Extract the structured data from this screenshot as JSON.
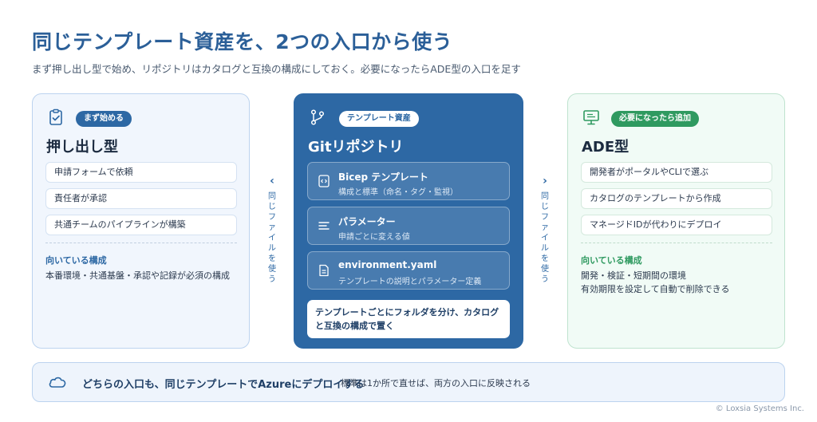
{
  "title": "同じテンプレート資産を、2つの入口から使う",
  "subtitle": "まず押し出し型で始め、リポジトリはカタログと互換の構成にしておく。必要になったらADE型の入口を足す",
  "left_card": {
    "icon": "clipboard-check-icon",
    "badge": "まず始める",
    "title": "押し出し型",
    "steps": [
      "申請フォームで依頼",
      "責任者が承認",
      "共通チームのパイプラインが構築"
    ],
    "fit_title": "向いている構成",
    "fit_lines": [
      "本番環境・共通基盤・承認や記録が必須の構成"
    ]
  },
  "center_card": {
    "icon": "git-branch-icon",
    "badge": "テンプレート資産",
    "title": "Gitリポジトリ",
    "files": [
      {
        "icon": "code-file-icon",
        "name": "Bicep テンプレート",
        "desc": "構成と標準（命名・タグ・監視）"
      },
      {
        "icon": "parameters-icon",
        "name": "パラメーター",
        "desc": "申請ごとに変える値"
      },
      {
        "icon": "document-icon",
        "name": "environment.yaml",
        "desc": "テンプレートの説明とパラメーター定義"
      }
    ],
    "note": "テンプレートごとにフォルダを分け、カタログと互換の構成で置く"
  },
  "right_card": {
    "icon": "monitor-icon",
    "badge": "必要になったら追加",
    "title": "ADE型",
    "steps": [
      "開発者がポータルやCLIで選ぶ",
      "カタログのテンプレートから作成",
      "マネージドIDが代わりにデプロイ"
    ],
    "fit_title": "向いている構成",
    "fit_lines": [
      "開発・検証・短期間の環境",
      "有効期限を設定して自動で削除できる"
    ]
  },
  "connectors": {
    "left_label": "同じファイルを使う",
    "right_label": "同じファイルを使う"
  },
  "footer": {
    "icon": "cloud-icon",
    "main": "どちらの入口も、同じテンプレートでAzureにデプロイする",
    "sub": "標準は1か所で直せば、両方の入口に反映される"
  },
  "copyright": "© Loxsia Systems Inc.",
  "colors": {
    "primary": "#2d68a4",
    "green": "#2f9a60",
    "title": "#2b5f98"
  }
}
